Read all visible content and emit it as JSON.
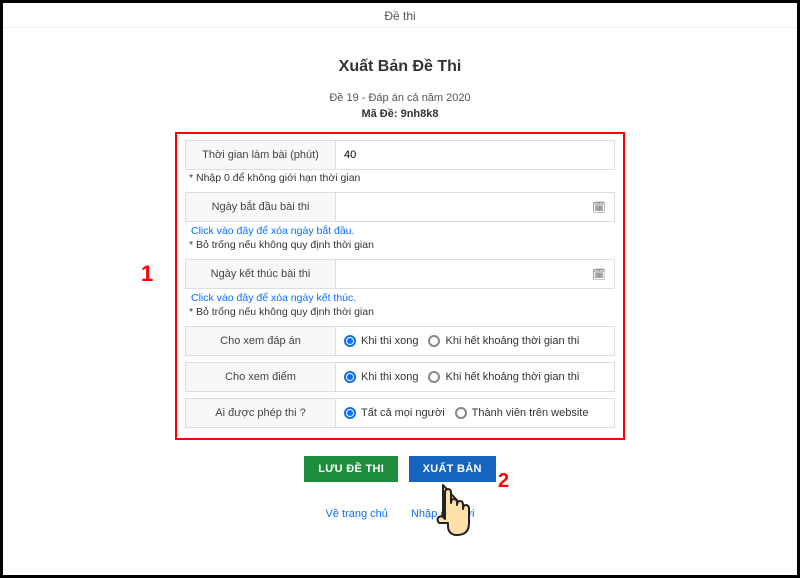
{
  "header": {
    "breadcrumb": "Đề thi"
  },
  "page": {
    "title": "Xuất Bản Đề Thi",
    "subtitle": "Đề 19 - Đáp án cả năm 2020",
    "code_label": "Mã Đề:",
    "code_value": "9nh8k8"
  },
  "form": {
    "duration": {
      "label": "Thời gian làm bài (phút)",
      "value": "40",
      "note": "* Nhập 0 để không giới hạn thời gian"
    },
    "start": {
      "label": "Ngày bắt đầu bài thi",
      "value": "",
      "clear_link": "Click vào đây để xóa ngày bắt đầu.",
      "note": "* Bỏ trống nếu không quy định thời gian"
    },
    "end": {
      "label": "Ngày kết thúc bài thi",
      "value": "",
      "clear_link": "Click vào đây để xóa ngày kết thúc.",
      "note": "* Bỏ trống nếu không quy định thời gian"
    },
    "answers": {
      "label": "Cho xem đáp án",
      "opt1": "Khi thi xong",
      "opt2": "Khi hết khoảng thời gian thi"
    },
    "scores": {
      "label": "Cho xem điểm",
      "opt1": "Khi thi xong",
      "opt2": "Khi hết khoảng thời gian thi"
    },
    "allowed": {
      "label": "Ai được phép thi ?",
      "opt1": "Tất cả mọi người",
      "opt2": "Thành viên trên website"
    }
  },
  "buttons": {
    "save": "LƯU ĐỀ THI",
    "publish": "XUẤT BẢN"
  },
  "links": {
    "home": "Về trang chủ",
    "new": "Nhập đề mới"
  },
  "callouts": {
    "one": "1",
    "two": "2"
  }
}
